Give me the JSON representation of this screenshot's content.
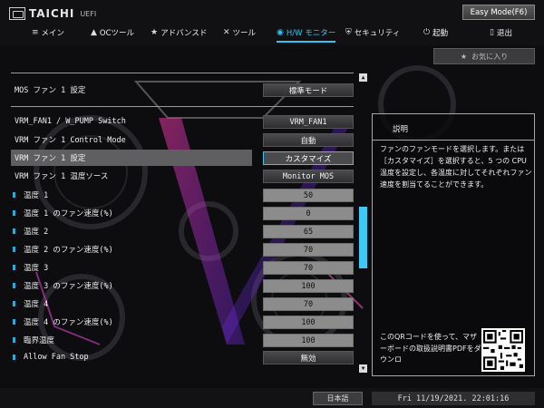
{
  "app": {
    "logo_text": "TAICHI",
    "logo_sub": "UEFI",
    "easy_mode_label": "Easy Mode(F6)"
  },
  "nav": {
    "items": [
      {
        "icon": "≡",
        "label": "メイン"
      },
      {
        "icon": "🔥",
        "label": "OCツール"
      },
      {
        "icon": "★",
        "label": "アドバンスド"
      },
      {
        "icon": "✕",
        "label": "ツール"
      },
      {
        "icon": "◉",
        "label": "H/W モニター"
      },
      {
        "icon": "⛨",
        "label": "セキュリティ"
      },
      {
        "icon": "⏻",
        "label": "起動"
      },
      {
        "icon": "▯",
        "label": "退出"
      }
    ],
    "active_index": 4
  },
  "favorites": {
    "icon": "★",
    "label": "お気に入り"
  },
  "settings": [
    {
      "label": "MOS ファン 1 設定",
      "value": "標準モード",
      "style": "btn",
      "sub": false
    },
    {
      "label": "VRM_FAN1 / W_PUMP Switch",
      "value": "VRM_FAN1",
      "style": "btn",
      "sub": false
    },
    {
      "label": "VRM ファン 1 Control Mode",
      "value": "自動",
      "style": "btn",
      "sub": false
    },
    {
      "label": "VRM ファン 1 設定",
      "value": "カスタマイズ",
      "style": "sel",
      "sub": false
    },
    {
      "label": "VRM ファン 1 温度ソース",
      "value": "Monitor MOS",
      "style": "btn",
      "sub": false
    },
    {
      "label": "温度 1",
      "value": "50",
      "style": "num",
      "sub": true
    },
    {
      "label": "温度 1 のファン速度(%)",
      "value": "0",
      "style": "num",
      "sub": true
    },
    {
      "label": "温度 2",
      "value": "65",
      "style": "num",
      "sub": true
    },
    {
      "label": "温度 2 のファン速度(%)",
      "value": "70",
      "style": "num",
      "sub": true
    },
    {
      "label": "温度 3",
      "value": "70",
      "style": "num",
      "sub": true
    },
    {
      "label": "温度 3 のファン速度(%)",
      "value": "100",
      "style": "num",
      "sub": true
    },
    {
      "label": "温度 4",
      "value": "70",
      "style": "num",
      "sub": true
    },
    {
      "label": "温度 4 のファン速度(%)",
      "value": "100",
      "style": "num",
      "sub": true
    },
    {
      "label": "臨界温度",
      "value": "100",
      "style": "num",
      "sub": true
    },
    {
      "label": "Allow Fan Stop",
      "value": "無効",
      "style": "btn",
      "sub": true
    }
  ],
  "description": {
    "title": "説明",
    "text": "ファンのファンモードを選択します。または［カスタマイズ］を選択すると、5 つの CPU 温度を設定し、各温度に対してそれぞれファン速度を割当てることができます。",
    "qr_text": "このQRコードを使って、マザーボードの取扱説明書PDFをダウンロ"
  },
  "footer": {
    "language": "日本語",
    "datetime": "Fri 11/19/2021. 22:01:16"
  },
  "colors": {
    "accent": "#34c3f0"
  }
}
